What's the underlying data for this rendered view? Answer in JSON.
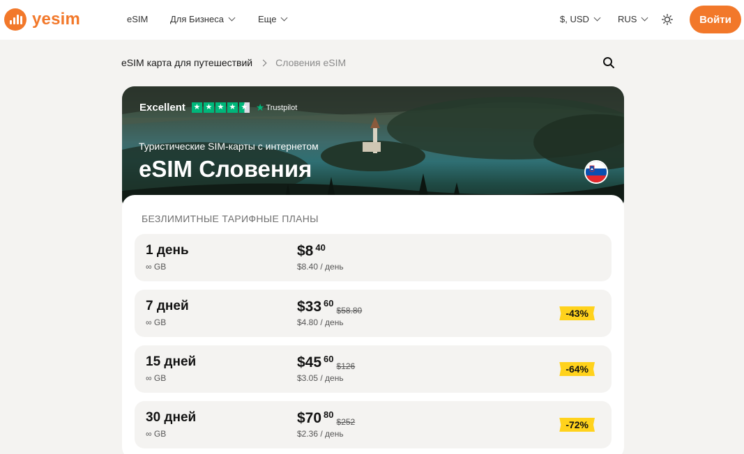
{
  "header": {
    "logo_text": "yesim",
    "nav": [
      {
        "label": "eSIM"
      },
      {
        "label": "Для Бизнеса"
      },
      {
        "label": "Еще"
      }
    ],
    "currency": "$, USD",
    "language": "RUS",
    "login_label": "Войти",
    "accent_color": "#f2782a"
  },
  "breadcrumb": {
    "home": "eSIM карта для путешествий",
    "current": "Словения eSIM"
  },
  "hero": {
    "rating_label": "Excellent",
    "rating_brand": "Trustpilot",
    "rating_stars": 4.5,
    "subtitle": "Туристические SIM-карты с интернетом",
    "title": "eSIM Словения",
    "flag": "slovenia-flag-icon"
  },
  "plans": {
    "heading": "БЕЗЛИМИТНЫЕ ТАРИФНЫЕ ПЛАНЫ",
    "items": [
      {
        "duration": "1 день",
        "data": "∞ GB",
        "price_int": "$8",
        "price_cents": "40",
        "old_price": "",
        "per_day": "$8.40 / день",
        "discount": ""
      },
      {
        "duration": "7 дней",
        "data": "∞ GB",
        "price_int": "$33",
        "price_cents": "60",
        "old_price": "$58.80",
        "per_day": "$4.80 / день",
        "discount": "-43%"
      },
      {
        "duration": "15 дней",
        "data": "∞ GB",
        "price_int": "$45",
        "price_cents": "60",
        "old_price": "$126",
        "per_day": "$3.05 / день",
        "discount": "-64%"
      },
      {
        "duration": "30 дней",
        "data": "∞ GB",
        "price_int": "$70",
        "price_cents": "80",
        "old_price": "$252",
        "per_day": "$2.36 / день",
        "discount": "-72%"
      }
    ],
    "badge_color": "#ffd21c"
  }
}
